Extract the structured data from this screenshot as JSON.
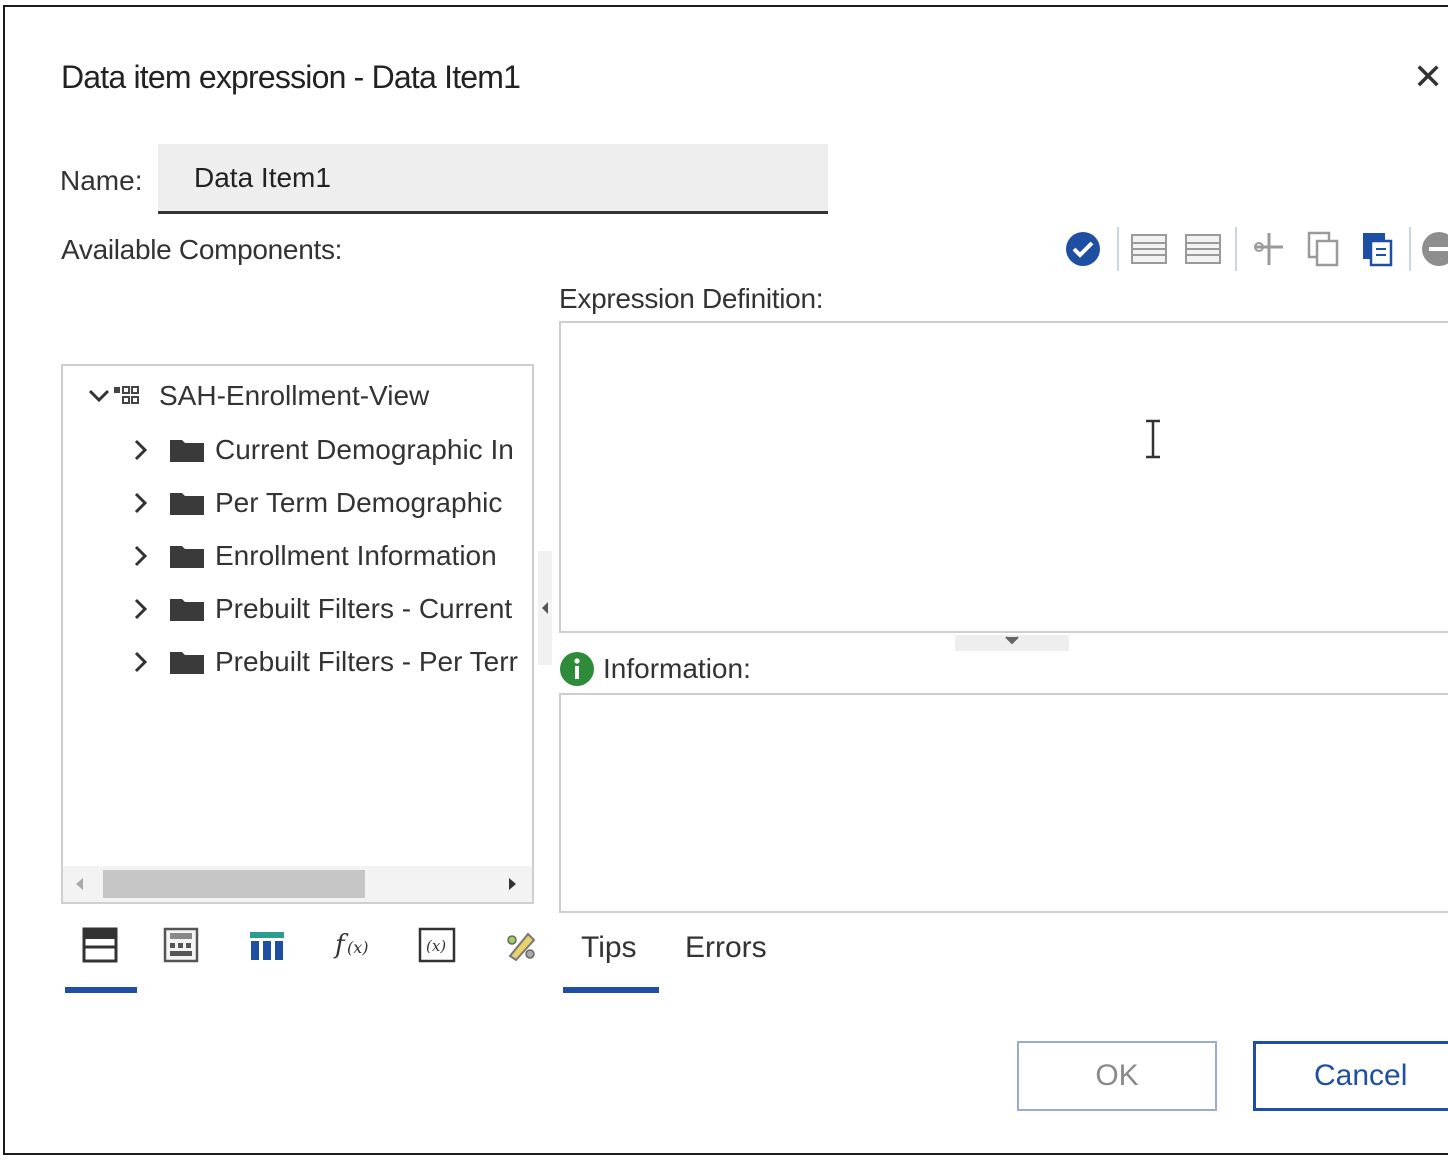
{
  "dialog": {
    "title": "Data item expression - Data Item1",
    "close_icon": "close-icon"
  },
  "name_field": {
    "label": "Name:",
    "value": "Data Item1"
  },
  "available_components": {
    "label": "Available Components:",
    "tree": {
      "root": {
        "label": "SAH-Enrollment-View",
        "icon": "package-icon",
        "expanded": true
      },
      "children": [
        {
          "label": "Current Demographic In",
          "icon": "folder-icon"
        },
        {
          "label": "Per Term Demographic",
          "icon": "folder-icon"
        },
        {
          "label": "Enrollment Information",
          "icon": "folder-icon"
        },
        {
          "label": "Prebuilt Filters - Current",
          "icon": "folder-icon"
        },
        {
          "label": "Prebuilt Filters - Per Terr",
          "icon": "folder-icon"
        }
      ]
    },
    "tabs": [
      {
        "icon": "data-items-icon",
        "active": true
      },
      {
        "icon": "queries-icon",
        "active": false
      },
      {
        "icon": "columns-icon",
        "active": false
      },
      {
        "icon": "functions-icon",
        "active": false
      },
      {
        "icon": "parameters-icon",
        "active": false
      },
      {
        "icon": "macros-icon",
        "active": false
      }
    ]
  },
  "expression": {
    "label": "Expression Definition:",
    "value": ""
  },
  "toolbar": {
    "buttons": [
      "validate-icon",
      "comment-icon",
      "uncomment-icon",
      "cut-icon",
      "copy-icon",
      "paste-icon",
      "more-icon"
    ]
  },
  "information": {
    "label": "Information:",
    "tabs": [
      {
        "label": "Tips",
        "active": true
      },
      {
        "label": "Errors",
        "active": false
      }
    ]
  },
  "buttons": {
    "ok": "OK",
    "cancel": "Cancel"
  },
  "colors": {
    "accent": "#1f4fa3",
    "info_green": "#2e8b3a"
  }
}
